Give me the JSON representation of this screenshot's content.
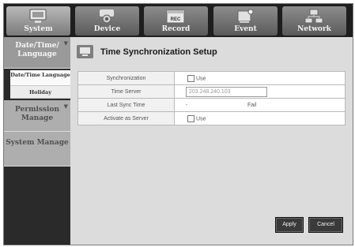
{
  "nav": {
    "tabs": [
      {
        "label": "System",
        "icon": "system-icon",
        "active": true
      },
      {
        "label": "Device",
        "icon": "camera-icon"
      },
      {
        "label": "Record",
        "icon": "record-icon"
      },
      {
        "label": "Event",
        "icon": "event-icon"
      },
      {
        "label": "Network",
        "icon": "network-icon"
      }
    ]
  },
  "sidebar": {
    "date_group": "Date/Time/ Language",
    "date_sub": "Date/Time Language",
    "holiday": "Holiday",
    "permission": "Permission Manage",
    "system_manage": "System Manage"
  },
  "page": {
    "title": "Time Synchronization Setup",
    "icon": "settings-page-icon"
  },
  "form": {
    "sync_label": "Synchronization",
    "sync_check_label": "Use",
    "server_label": "Time Server",
    "server_value": "203.248.240.103",
    "last_sync_label": "Last Sync Time",
    "last_sync_value": "-",
    "last_sync_status": "Fail",
    "activate_label": "Activate as Server",
    "activate_check_label": "Use"
  },
  "buttons": {
    "apply": "Apply",
    "cancel": "Cancel"
  },
  "colors": {
    "topbar": "#1e1e1e",
    "content_bg": "#dcdcdc",
    "button": "#3a3a3a"
  }
}
